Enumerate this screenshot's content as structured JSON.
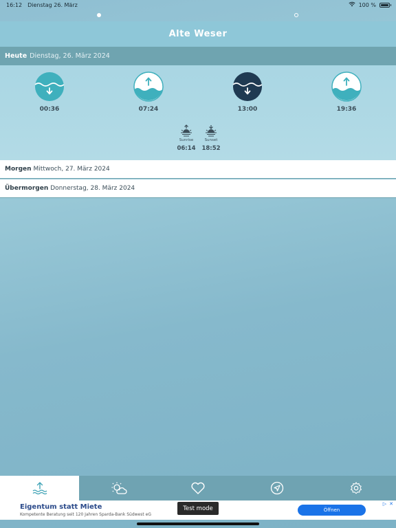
{
  "statusbar": {
    "time": "16:12",
    "date": "Dienstag 26. März",
    "battery": "100 %",
    "battery_level": 1.0,
    "icons": [
      "wifi-icon",
      "battery-icon"
    ]
  },
  "pager": {
    "pages": 2,
    "current": 1
  },
  "header": {
    "title": "Alte Weser"
  },
  "today": {
    "label": "Heute",
    "date": "Dienstag, 26. März 2024",
    "tides": [
      {
        "time": "00:36",
        "direction": "low",
        "icon": "tide-low-icon",
        "highlighted": false
      },
      {
        "time": "07:24",
        "direction": "high",
        "icon": "tide-high-icon",
        "highlighted": false
      },
      {
        "time": "13:00",
        "direction": "low",
        "icon": "tide-low-icon",
        "highlighted": true
      },
      {
        "time": "19:36",
        "direction": "high",
        "icon": "tide-high-icon",
        "highlighted": false
      }
    ],
    "sun": [
      {
        "label": "Sunrise",
        "time": "06:14",
        "icon": "sunrise-icon"
      },
      {
        "label": "Sunset",
        "time": "18:52",
        "icon": "sunset-icon"
      }
    ]
  },
  "days": [
    {
      "label": "Morgen",
      "date": "Mittwoch, 27. März 2024"
    },
    {
      "label": "Übermorgen",
      "date": "Donnerstag, 28. März 2024"
    }
  ],
  "tabs": [
    {
      "name": "tab-tides",
      "icon": "tide-waves-icon",
      "active": true
    },
    {
      "name": "tab-weather",
      "icon": "sun-cloud-icon",
      "active": false
    },
    {
      "name": "tab-favorites",
      "icon": "heart-icon",
      "active": false
    },
    {
      "name": "tab-location",
      "icon": "navigation-arrow-icon",
      "active": false
    },
    {
      "name": "tab-settings",
      "icon": "gear-icon",
      "active": false
    }
  ],
  "ad": {
    "title": "Eigentum statt Miete",
    "subtitle": "Kompetente Beratung seit 120 Jahren Sparda-Bank Südwest eG",
    "test_mode": "Test mode",
    "open_label": "Öffnen"
  },
  "colors": {
    "accent": "#3fb0bd",
    "highlight_tide": "#1f3a52",
    "header_bar": "#8ec7d8",
    "today_bar": "#6fa4b0",
    "tab_bar": "#6fa3b2",
    "ad_button": "#1a73e8"
  }
}
